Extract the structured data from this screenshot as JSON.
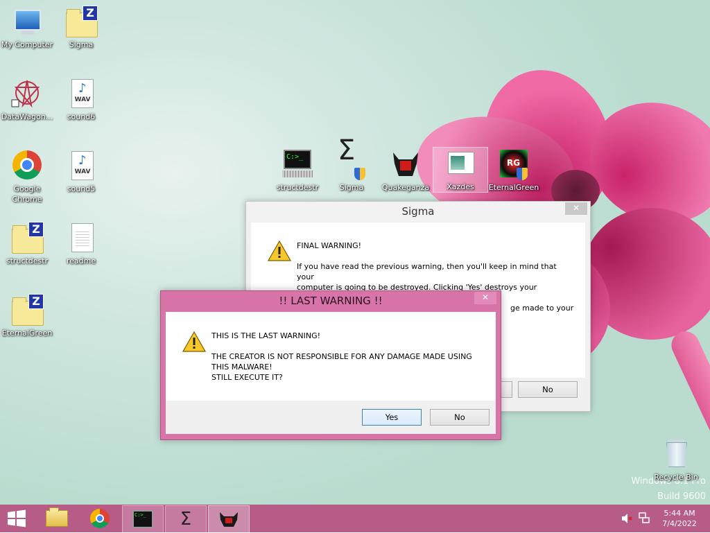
{
  "desktop": {
    "icons": [
      {
        "label": "My Computer"
      },
      {
        "label": "Sigma"
      },
      {
        "label": "DataWagon..."
      },
      {
        "label": "sound6"
      },
      {
        "label": "Google Chrome"
      },
      {
        "label": "sound5"
      },
      {
        "label": "structdestr"
      },
      {
        "label": "readme"
      },
      {
        "label": "EternalGreen"
      },
      {
        "label": "structdestr"
      },
      {
        "label": "Sigma"
      },
      {
        "label": "Quakeganza"
      },
      {
        "label": "Xazdes"
      },
      {
        "label": "EternalGreen"
      },
      {
        "label": "Recycle Bin"
      }
    ],
    "wav_label": "WAV",
    "terminal_prompt": "C:>_",
    "eternalgreen_badge": "RG",
    "z_badge": "Z",
    "sigma_glyph": "Σ",
    "watermark": {
      "line1": "Windows 8.1 Pro",
      "line2": "Build 9600"
    }
  },
  "dialog_sigma": {
    "title": "Sigma",
    "close": "✕",
    "message_lines": [
      "FINAL WARNING!",
      "",
      "If you have read the previous warning, then you'll keep in mind that",
      "your",
      "computer is going to be destroyed. Clicking 'Yes' destroys your",
      "",
      "ge made to your"
    ],
    "no_label": "No"
  },
  "dialog_last": {
    "title": "!! LAST WARNING !!",
    "close": "✕",
    "line1": "THIS IS THE LAST WARNING!",
    "line2": "THE CREATOR IS NOT RESPONSIBLE FOR ANY DAMAGE MADE USING",
    "line3": "THIS MALWARE!",
    "line4": "STILL EXECUTE IT?",
    "yes_label": "Yes",
    "no_label": "No"
  },
  "taskbar": {
    "sigma_glyph": "Σ",
    "clock_time": "5:44 AM",
    "clock_date": "7/4/2022"
  },
  "colors": {
    "taskbar": "#b75b87",
    "last_warning_frame": "#d874a8",
    "sigma_frame": "#f2f2f2",
    "desktop": "#cfe6df",
    "flower": "#e94f8e"
  }
}
